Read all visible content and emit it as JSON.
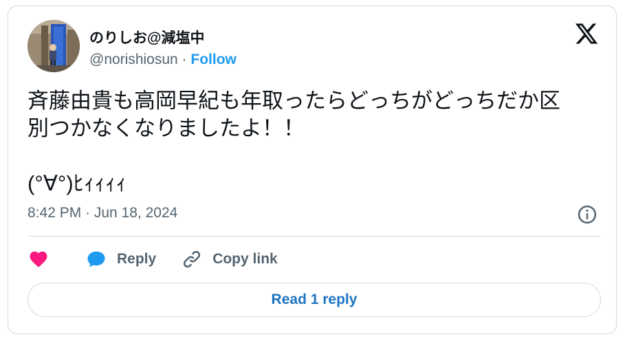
{
  "author": {
    "display_name": "のりしお@減塩中",
    "handle": "@norishiosun",
    "separator": " · ",
    "follow_label": "Follow"
  },
  "tweet": {
    "text": "斉藤由貴も高岡早紀も年取ったらどっちがどっちだか区\n別つかなくなりましたよ！！\n\n(°∀°)ﾋｨｨｨｨ",
    "timestamp": "8:42 PM · Jun 18, 2024"
  },
  "actions": {
    "reply_label": "Reply",
    "copy_link_label": "Copy link",
    "read_replies_label": "Read 1 reply"
  },
  "icons": {
    "platform_logo": "x-logo-icon",
    "info": "info-icon",
    "like": "heart-icon",
    "reply": "reply-bubble-icon",
    "copy_link": "link-icon"
  },
  "colors": {
    "accent": "#1d9bf0",
    "read_reply_text": "#1d73c2",
    "heart": "#f91880",
    "secondary_text": "#536471",
    "border": "#cfd9de"
  }
}
